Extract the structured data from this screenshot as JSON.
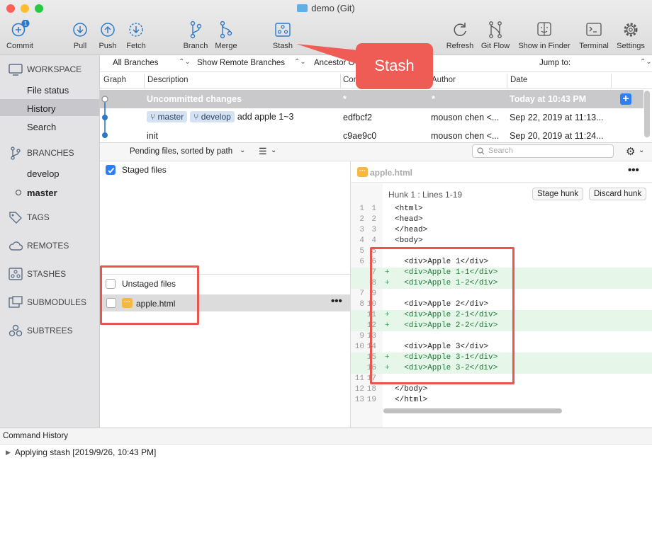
{
  "window": {
    "title": "demo (Git)"
  },
  "toolbar": {
    "commit": "Commit",
    "commit_badge": "1",
    "pull": "Pull",
    "push": "Push",
    "fetch": "Fetch",
    "branch": "Branch",
    "merge": "Merge",
    "stash": "Stash",
    "refresh": "Refresh",
    "gitflow": "Git Flow",
    "finder": "Show in Finder",
    "terminal": "Terminal",
    "settings": "Settings"
  },
  "sidebar": {
    "workspace": "WORKSPACE",
    "file_status": "File status",
    "history": "History",
    "search": "Search",
    "branches": "BRANCHES",
    "develop": "develop",
    "master": "master",
    "tags": "TAGS",
    "remotes": "REMOTES",
    "stashes": "STASHES",
    "submodules": "SUBMODULES",
    "subtrees": "SUBTREES"
  },
  "filters": {
    "all_branches": "All Branches",
    "remote": "Show Remote Branches",
    "ancestor": "Ancestor O",
    "jump": "Jump to:"
  },
  "columns": {
    "graph": "Graph",
    "description": "Description",
    "commit": "Com",
    "author": "Author",
    "date": "Date"
  },
  "commits": [
    {
      "desc": "Uncommitted changes",
      "hash": "*",
      "author": "*",
      "date": "Today at 10:43 PM"
    },
    {
      "tag1": "master",
      "tag2": "develop",
      "desc": "add apple 1~3",
      "hash": "edfbcf2",
      "author": "mouson chen <...",
      "date": "Sep 22, 2019 at 11:13..."
    },
    {
      "desc": "init",
      "hash": "c9ae9c0",
      "author": "mouson chen <...",
      "date": "Sep 20, 2019 at 11:24..."
    }
  ],
  "pending": {
    "sort_label": "Pending files, sorted by path",
    "search_placeholder": "Search"
  },
  "staged": {
    "label": "Staged files"
  },
  "unstaged": {
    "label": "Unstaged files",
    "file": "apple.html"
  },
  "diff": {
    "file": "apple.html",
    "hunk": "Hunk 1 : Lines 1-19",
    "stage": "Stage hunk",
    "discard": "Discard hunk",
    "lines": [
      {
        "o": "1",
        "n": "1",
        "t": "<html>",
        "a": false
      },
      {
        "o": "2",
        "n": "2",
        "t": "<head>",
        "a": false
      },
      {
        "o": "3",
        "n": "3",
        "t": "</head>",
        "a": false
      },
      {
        "o": "4",
        "n": "4",
        "t": "<body>",
        "a": false
      },
      {
        "o": "5",
        "n": "5",
        "t": "",
        "a": false
      },
      {
        "o": "6",
        "n": "6",
        "t": "  <div>Apple 1</div>",
        "a": false
      },
      {
        "o": "",
        "n": "7",
        "t": "  <div>Apple 1-1</div>",
        "a": true
      },
      {
        "o": "",
        "n": "8",
        "t": "  <div>Apple 1-2</div>",
        "a": true
      },
      {
        "o": "7",
        "n": "9",
        "t": "",
        "a": false
      },
      {
        "o": "8",
        "n": "10",
        "t": "  <div>Apple 2</div>",
        "a": false
      },
      {
        "o": "",
        "n": "11",
        "t": "  <div>Apple 2-1</div>",
        "a": true
      },
      {
        "o": "",
        "n": "12",
        "t": "  <div>Apple 2-2</div>",
        "a": true
      },
      {
        "o": "9",
        "n": "13",
        "t": "",
        "a": false
      },
      {
        "o": "10",
        "n": "14",
        "t": "  <div>Apple 3</div>",
        "a": false
      },
      {
        "o": "",
        "n": "15",
        "t": "  <div>Apple 3-1</div>",
        "a": true
      },
      {
        "o": "",
        "n": "16",
        "t": "  <div>Apple 3-2</div>",
        "a": true
      },
      {
        "o": "11",
        "n": "17",
        "t": "",
        "a": false
      },
      {
        "o": "12",
        "n": "18",
        "t": "</body>",
        "a": false
      },
      {
        "o": "13",
        "n": "19",
        "t": "</html>",
        "a": false
      }
    ]
  },
  "command_history": {
    "title": "Command History",
    "entry": "Applying stash [2019/9/26, 10:43 PM]"
  },
  "callout": {
    "text": "Stash"
  }
}
